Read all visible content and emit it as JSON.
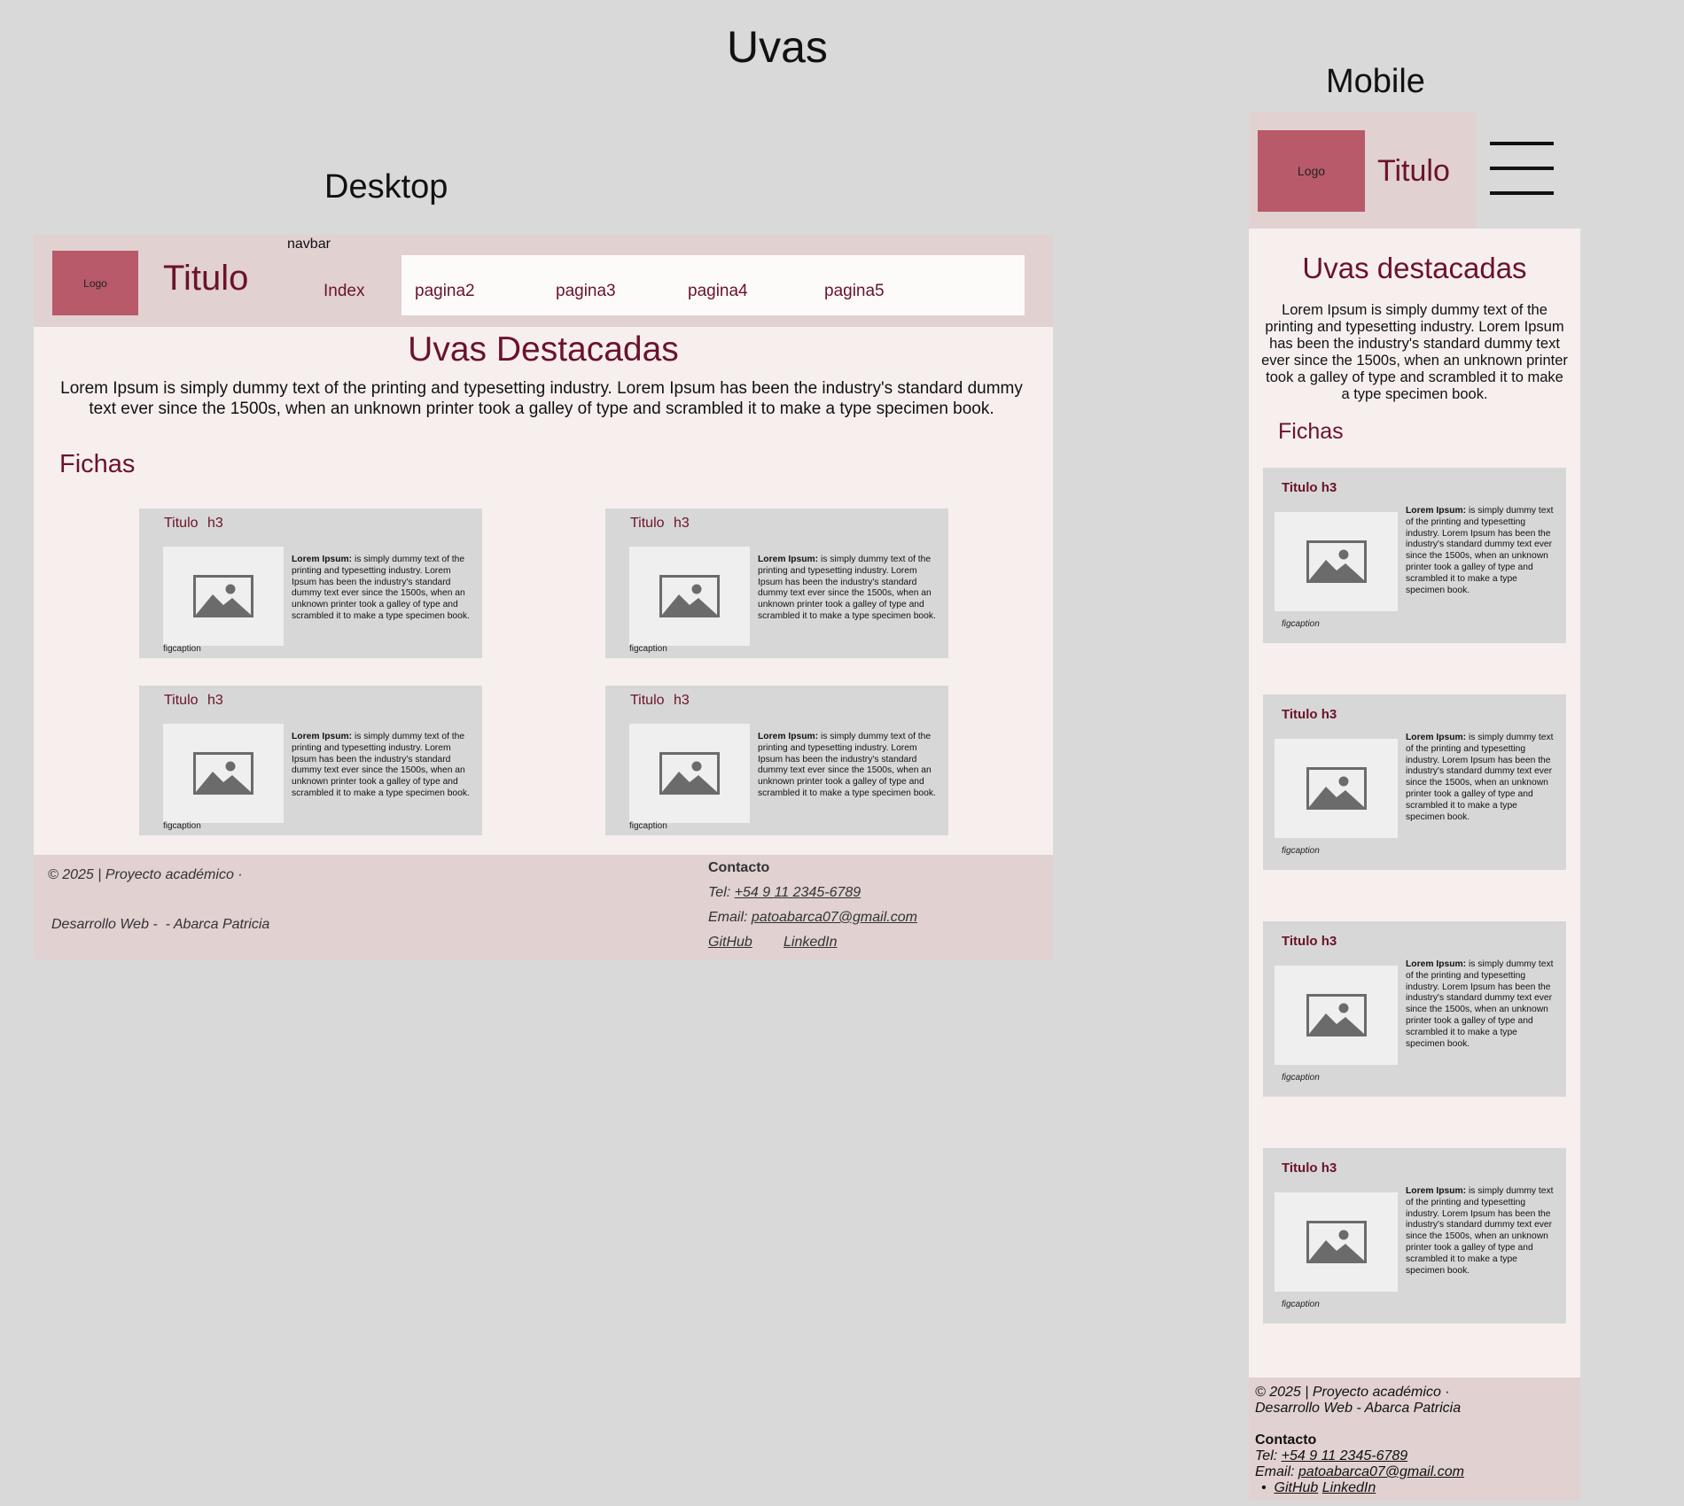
{
  "page_title": "Uvas",
  "labels": {
    "desktop": "Desktop",
    "mobile": "Mobile"
  },
  "colors": {
    "background": "#d9d9d9",
    "header": "#e1d1d1",
    "body": "#f6efee",
    "logo": "#b85a6a",
    "accent": "#6b1328",
    "card": "#d7d7d7"
  },
  "desktop": {
    "header": {
      "logo": "Logo",
      "title": "Titulo",
      "navbar_label": "navbar",
      "nav": [
        "Index",
        "pagina2",
        "pagina3",
        "pagina4",
        "pagina5"
      ]
    },
    "heading": "Uvas Destacadas",
    "intro": "Lorem Ipsum is simply dummy text of the printing and typesetting industry. Lorem Ipsum has been the industry's standard dummy text ever since the 1500s, when an unknown printer took a galley of type and scrambled it to make a type specimen book.",
    "section": "Fichas",
    "cards": [
      {
        "title": "Titulo h3",
        "bold": "Lorem Ipsum:",
        "text": " is simply dummy text of the printing and typesetting industry. Lorem Ipsum has been the industry's standard dummy text ever since the 1500s, when an unknown printer took a galley of type and scrambled it to make a type specimen book.",
        "caption": "figcaption",
        "image_icon": "image-placeholder-icon"
      },
      {
        "title": "Titulo h3",
        "bold": "Lorem Ipsum:",
        "text": " is simply dummy text of the printing and typesetting industry. Lorem Ipsum has been the industry's standard dummy text ever since the 1500s, when an unknown printer took a galley of type and scrambled it to make a type specimen book.",
        "caption": "figcaption",
        "image_icon": "image-placeholder-icon"
      },
      {
        "title": "Titulo h3",
        "bold": "Lorem Ipsum:",
        "text": " is simply dummy text of the printing and typesetting industry. Lorem Ipsum has been the industry's standard dummy text ever since the 1500s, when an unknown printer took a galley of type and scrambled it to make a type specimen book.",
        "caption": "figcaption",
        "image_icon": "image-placeholder-icon"
      },
      {
        "title": "Titulo h3",
        "bold": "Lorem Ipsum:",
        "text": " is simply dummy text of the printing and typesetting industry. Lorem Ipsum has been the industry's standard dummy text ever since the 1500s, when an unknown printer took a galley of type and scrambled it to make a type specimen book.",
        "caption": "figcaption",
        "image_icon": "image-placeholder-icon"
      }
    ],
    "footer": {
      "copyright": "© 2025 | Proyecto académico ·",
      "author": "Desarrollo Web -  - Abarca Patricia",
      "contact_heading": "Contacto",
      "tel_label": "Tel:",
      "tel": "+54 9 11 2345-6789",
      "email_label": "Email:",
      "email": "patoabarca07@gmail.com",
      "github": "GitHub",
      "linkedin": "LinkedIn"
    }
  },
  "mobile": {
    "header": {
      "logo": "Logo",
      "title": "Titulo",
      "menu_icon": "hamburger-menu-icon"
    },
    "heading": "Uvas destacadas",
    "intro": "Lorem Ipsum is simply dummy text of the printing and typesetting industry. Lorem Ipsum has been the industry's standard dummy text ever since the 1500s, when an unknown printer took a galley of type and scrambled it to make a type specimen book.",
    "section": "Fichas",
    "cards": [
      {
        "title": "Titulo h3",
        "bold": "Lorem Ipsum:",
        "text": " is simply dummy text of the printing and typesetting industry. Lorem Ipsum has been the industry's standard dummy text ever since the 1500s, when an unknown printer took a galley of type and scrambled it to make a type specimen book.",
        "caption": "figcaption"
      },
      {
        "title": "Titulo h3",
        "bold": "Lorem Ipsum:",
        "text": " is simply dummy text of the printing and typesetting industry. Lorem Ipsum has been the industry's standard dummy text ever since the 1500s, when an unknown printer took a galley of type and scrambled it to make a type specimen book.",
        "caption": "figcaption"
      },
      {
        "title": "Titulo h3",
        "bold": "Lorem Ipsum:",
        "text": " is simply dummy text of the printing and typesetting industry. Lorem Ipsum has been the industry's standard dummy text ever since the 1500s, when an unknown printer took a galley of type and scrambled it to make a type specimen book.",
        "caption": "figcaption"
      },
      {
        "title": "Titulo h3",
        "bold": "Lorem Ipsum:",
        "text": " is simply dummy text of the printing and typesetting industry. Lorem Ipsum has been the industry's standard dummy text ever since the 1500s, when an unknown printer took a galley of type and scrambled it to make a type specimen book.",
        "caption": "figcaption"
      }
    ],
    "footer": {
      "copyright": "© 2025 | Proyecto académico ·",
      "author": "Desarrollo Web - Abarca Patricia",
      "contact_heading": "Contacto",
      "tel_label": "Tel:",
      "tel": "+54 9 11 2345-6789",
      "email_label": "Email:",
      "email": "patoabarca07@gmail.com",
      "github": "GitHub",
      "linkedin": "LinkedIn"
    }
  }
}
